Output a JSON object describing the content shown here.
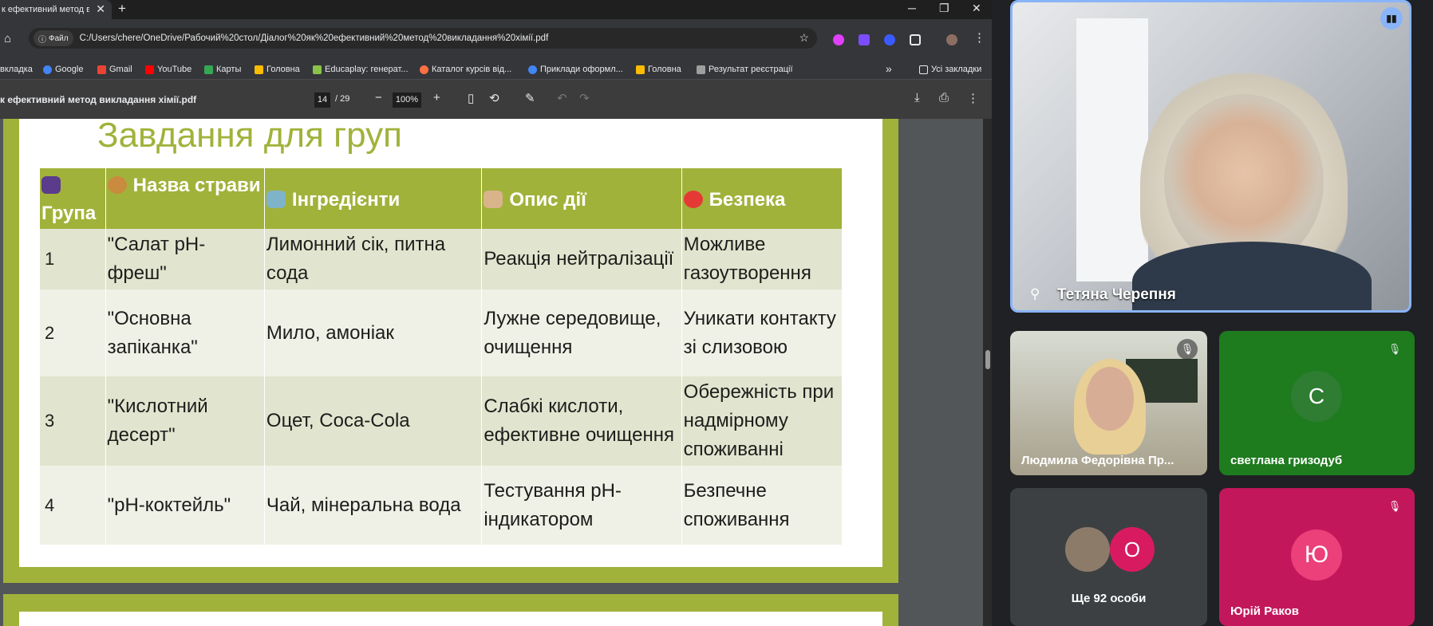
{
  "browser": {
    "tab_title": "к ефективний метод в",
    "tab_close": "✕",
    "new_tab": "+",
    "window_controls": [
      "─",
      "❐",
      "✕"
    ],
    "site_chip": "Файл",
    "url": "C:/Users/chere/OneDrive/Рабочий%20стол/Діалог%20як%20ефективний%20метод%20викладання%20хімії.pdf",
    "bookmarks": [
      {
        "label": "вкладка",
        "color": "#5f6368"
      },
      {
        "label": "Google",
        "color": "#4285f4"
      },
      {
        "label": "Gmail",
        "color": "#ea4335"
      },
      {
        "label": "YouTube",
        "color": "#ff0000"
      },
      {
        "label": "Карты",
        "color": "#34a853"
      },
      {
        "label": "Головна",
        "color": "#fbbc04"
      },
      {
        "label": "Educaplay: генерат...",
        "color": "#8bc34a"
      },
      {
        "label": "Каталог курсів від...",
        "color": "#ff7043"
      },
      {
        "label": "Приклади оформл...",
        "color": "#4285f4"
      },
      {
        "label": "Головна",
        "color": "#fbbc04"
      },
      {
        "label": "Результат реєстрації",
        "color": "#9e9e9e"
      }
    ],
    "bookmarks_more": "»",
    "all_bookmarks": "Усі закладки"
  },
  "pdf": {
    "title": "к ефективний метод викладання хімії.pdf",
    "page": "14",
    "total": "/ 29",
    "zoom": "100%"
  },
  "slide": {
    "title": "Завдання для груп",
    "headers": [
      {
        "text": "Група",
        "icon_color": "#5b3b8c",
        "icon": "people-icon"
      },
      {
        "text": "Назва страви",
        "icon_color": "#c98b3e",
        "icon": "food-icon"
      },
      {
        "text": "Інгредієнти",
        "icon_color": "#7fb3c9",
        "icon": "test-tube-icon"
      },
      {
        "text": "Опис дії",
        "icon_color": "#d9b48a",
        "icon": "clipboard-icon"
      },
      {
        "text": "Безпека",
        "icon_color": "#e53935",
        "icon": "red-circle-icon"
      }
    ],
    "rows": [
      [
        "1",
        "\"Салат pH-фреш\"",
        "Лимонний сік, питна сода",
        "Реакція нейтралізації",
        "Можливе газоутворення"
      ],
      [
        "2",
        "\"Основна запіканка\"",
        "Мило, амоніак",
        "Лужне середовище, очищення",
        "Уникати контакту зі слизовою"
      ],
      [
        "3",
        "\"Кислотний десерт\"",
        "Оцет, Coca-Cola",
        "Слабкі кислоти, ефективне очищення",
        "Обережність при надмірному споживанні"
      ],
      [
        "4",
        "\"pH-коктейль\"",
        "Чай, мінеральна вода",
        "Тестування pH-індикатором",
        "Безпечне споживання"
      ]
    ]
  },
  "meet": {
    "presenter": "Тетяна Черепня",
    "tiles": [
      {
        "name": "Людмила Федорівна Пр...",
        "initial": ""
      },
      {
        "name": "светлана гризодуб",
        "initial": "С"
      },
      {
        "name": "Ще 92 особи",
        "initial": "О"
      },
      {
        "name": "Юрій Раков",
        "initial": "Ю"
      }
    ]
  },
  "colors": {
    "slide_green": "#a1b23a",
    "speaking": "#8ab4f8"
  }
}
